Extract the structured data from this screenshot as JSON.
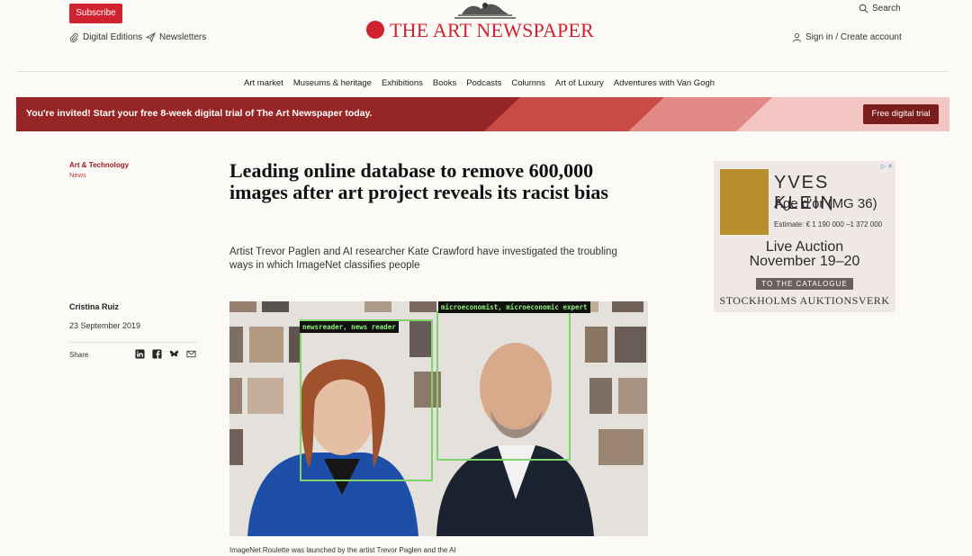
{
  "header": {
    "subscribe_label": "Subscribe",
    "digital_editions_label": "Digital Editions",
    "newsletters_label": "Newsletters",
    "logo_text": "THE ART NEWSPAPER",
    "search_label": "Search",
    "account_label": "Sign in / Create account"
  },
  "nav": {
    "items": [
      "Art market",
      "Museums & heritage",
      "Exhibitions",
      "Books",
      "Podcasts",
      "Columns",
      "Art of Luxury",
      "Adventures with Van Gogh"
    ]
  },
  "banner": {
    "text": "You're invited! Start your free 8-week digital trial of The Art Newspaper today.",
    "button_label": "Free digital trial"
  },
  "article": {
    "section": "Art & Technology",
    "type": "News",
    "headline": "Leading online database to remove 600,000 images after art project reveals its racist bias",
    "standfirst": "Artist Trevor Paglen and AI researcher Kate Crawford have investigated the troubling ways in which ImageNet classifies people",
    "author": "Cristina Ruiz",
    "date": "23 September 2019",
    "share_label": "Share",
    "image": {
      "label_left": "newsreader, news reader",
      "label_right": "microeconomist, microeconomic expert"
    },
    "caption": "ImageNet Roulette was launched by the artist Trevor Paglen and the AI"
  },
  "ad": {
    "title": "YVES KLEIN",
    "subtitle": "Âge d'or (MG 36)",
    "estimate": "Estimate: € 1 190 000 –1 372 000",
    "auction_line1": "Live Auction",
    "auction_line2": "November 19–20",
    "cta": "TO THE CATALOGUE",
    "house": "STOCKHOLMS AUKTIONSVERK"
  },
  "colors": {
    "brand_red": "#d1222f",
    "banner_dark": "#962525",
    "detection_green": "#7fd46b"
  },
  "icons": {
    "share": [
      "linkedin-icon",
      "facebook-icon",
      "bluesky-icon",
      "mail-icon"
    ]
  }
}
